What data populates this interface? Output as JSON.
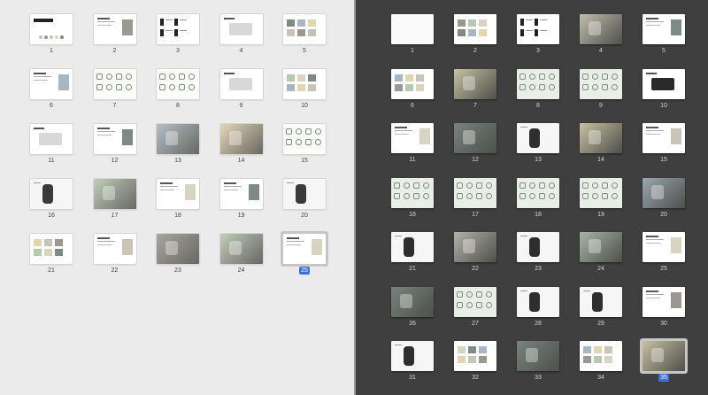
{
  "left": {
    "slides": [
      {
        "num": "1",
        "kind": "title",
        "title": "Portfolio"
      },
      {
        "num": "2",
        "kind": "doc"
      },
      {
        "num": "3",
        "kind": "numbers"
      },
      {
        "num": "4",
        "kind": "product"
      },
      {
        "num": "5",
        "kind": "grid"
      },
      {
        "num": "6",
        "kind": "doc"
      },
      {
        "num": "7",
        "kind": "sketch"
      },
      {
        "num": "8",
        "kind": "sketch"
      },
      {
        "num": "9",
        "kind": "product"
      },
      {
        "num": "10",
        "kind": "grid"
      },
      {
        "num": "11",
        "kind": "product"
      },
      {
        "num": "12",
        "kind": "doc"
      },
      {
        "num": "13",
        "kind": "photo"
      },
      {
        "num": "14",
        "kind": "photo"
      },
      {
        "num": "15",
        "kind": "sketch"
      },
      {
        "num": "16",
        "kind": "object"
      },
      {
        "num": "17",
        "kind": "photo"
      },
      {
        "num": "18",
        "kind": "doc"
      },
      {
        "num": "19",
        "kind": "doc"
      },
      {
        "num": "20",
        "kind": "object"
      },
      {
        "num": "21",
        "kind": "grid"
      },
      {
        "num": "22",
        "kind": "doc"
      },
      {
        "num": "23",
        "kind": "photo"
      },
      {
        "num": "24",
        "kind": "photo"
      },
      {
        "num": "25",
        "kind": "doc",
        "selected": true
      }
    ]
  },
  "right": {
    "slides": [
      {
        "num": "1",
        "kind": "blank"
      },
      {
        "num": "2",
        "kind": "grid"
      },
      {
        "num": "3",
        "kind": "numbers"
      },
      {
        "num": "4",
        "kind": "photo"
      },
      {
        "num": "5",
        "kind": "doc"
      },
      {
        "num": "6",
        "kind": "grid"
      },
      {
        "num": "7",
        "kind": "photo"
      },
      {
        "num": "8",
        "kind": "sketch"
      },
      {
        "num": "9",
        "kind": "sketch"
      },
      {
        "num": "10",
        "kind": "product"
      },
      {
        "num": "11",
        "kind": "doc"
      },
      {
        "num": "12",
        "kind": "photo"
      },
      {
        "num": "13",
        "kind": "object"
      },
      {
        "num": "14",
        "kind": "photo"
      },
      {
        "num": "15",
        "kind": "doc"
      },
      {
        "num": "16",
        "kind": "sketch"
      },
      {
        "num": "17",
        "kind": "sketch"
      },
      {
        "num": "18",
        "kind": "sketch"
      },
      {
        "num": "19",
        "kind": "sketch"
      },
      {
        "num": "20",
        "kind": "photo"
      },
      {
        "num": "21",
        "kind": "object"
      },
      {
        "num": "22",
        "kind": "photo"
      },
      {
        "num": "23",
        "kind": "object"
      },
      {
        "num": "24",
        "kind": "photo"
      },
      {
        "num": "25",
        "kind": "doc"
      },
      {
        "num": "26",
        "kind": "photo"
      },
      {
        "num": "27",
        "kind": "sketch"
      },
      {
        "num": "28",
        "kind": "object"
      },
      {
        "num": "29",
        "kind": "object"
      },
      {
        "num": "30",
        "kind": "doc"
      },
      {
        "num": "31",
        "kind": "object"
      },
      {
        "num": "32",
        "kind": "grid"
      },
      {
        "num": "33",
        "kind": "photo"
      },
      {
        "num": "34",
        "kind": "grid"
      },
      {
        "num": "35",
        "kind": "photo",
        "selected": true
      }
    ]
  },
  "colors": {
    "selection_badge": "#3d6fd8",
    "left_background": "#ebebeb",
    "right_background": "#3f3f3f"
  }
}
